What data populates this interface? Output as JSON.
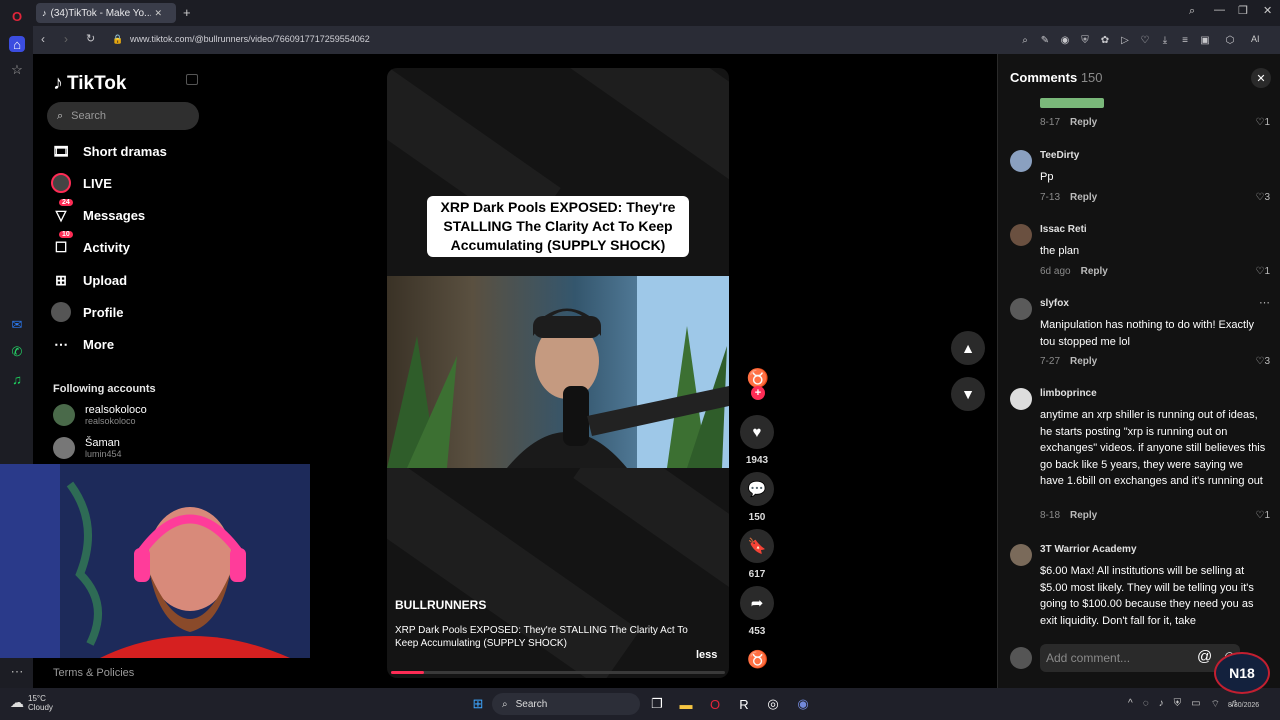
{
  "browser": {
    "tab_title": "(34)TikTok - Make Yo...",
    "url": "www.tiktok.com/@bullrunners/video/7660917717259554062",
    "ai_label": "AI"
  },
  "sidebar": {
    "logo": "TikTok",
    "search_placeholder": "Search",
    "items": [
      {
        "label": "Short dramas"
      },
      {
        "label": "LIVE"
      },
      {
        "label": "Messages",
        "badge": "24"
      },
      {
        "label": "Activity",
        "badge": "10"
      },
      {
        "label": "Upload"
      },
      {
        "label": "Profile"
      },
      {
        "label": "More"
      }
    ],
    "following_title": "Following accounts",
    "accounts": [
      {
        "name": "realsokoloco",
        "handle": "realsokoloco"
      },
      {
        "name": "Šaman",
        "handle": "lumin454"
      }
    ],
    "terms": "Terms & Policies"
  },
  "video": {
    "headline": "XRP Dark Pools EXPOSED: They're STALLING The Clarity Act To Keep Accumulating (SUPPLY SHOCK)",
    "author": "BULLRUNNERS",
    "description": "XRP Dark Pools EXPOSED: They're STALLING The Clarity Act To Keep Accumulating (SUPPLY SHOCK)",
    "less": "less",
    "progress": 0.1,
    "likes": "1943",
    "comments": "150",
    "saves": "617",
    "shares": "453"
  },
  "comments": {
    "title": "Comments",
    "count": "150",
    "list": [
      {
        "user": "",
        "text": "",
        "date": "8-17",
        "reply": "Reply",
        "likes": "1"
      },
      {
        "user": "TeeDirty",
        "text": "Pp",
        "date": "7-13",
        "reply": "Reply",
        "likes": "3"
      },
      {
        "user": "Issac Reti",
        "text": "the plan",
        "date": "6d ago",
        "reply": "Reply",
        "likes": "1"
      },
      {
        "user": "slyfox",
        "text": "Manipulation has nothing to do with! Exactly tou stopped me lol",
        "date": "7-27",
        "reply": "Reply",
        "likes": "3"
      },
      {
        "user": "limboprince",
        "text": "anytime an xrp shiller is running out of ideas, he starts posting \"xrp is running out on exchanges\" videos. if anyone still believes this go back like 5 years, they were saying we have 1.6bill on exchanges and it's running out",
        "date": "8-18",
        "reply": "Reply",
        "likes": "1"
      },
      {
        "user": "3T Warrior Academy",
        "text": "$6.00 Max! All institutions will be selling at $5.00 most likely. They will be telling you it's going to $100.00 because they need you as exit liquidity. Don't fall for it, take",
        "date": "",
        "reply": "",
        "likes": ""
      }
    ],
    "add_placeholder": "Add comment..."
  },
  "taskbar": {
    "temp": "15°C",
    "weather": "Cloudy",
    "search": "Search",
    "date": "8/30/2026",
    "overlay": "N18"
  }
}
